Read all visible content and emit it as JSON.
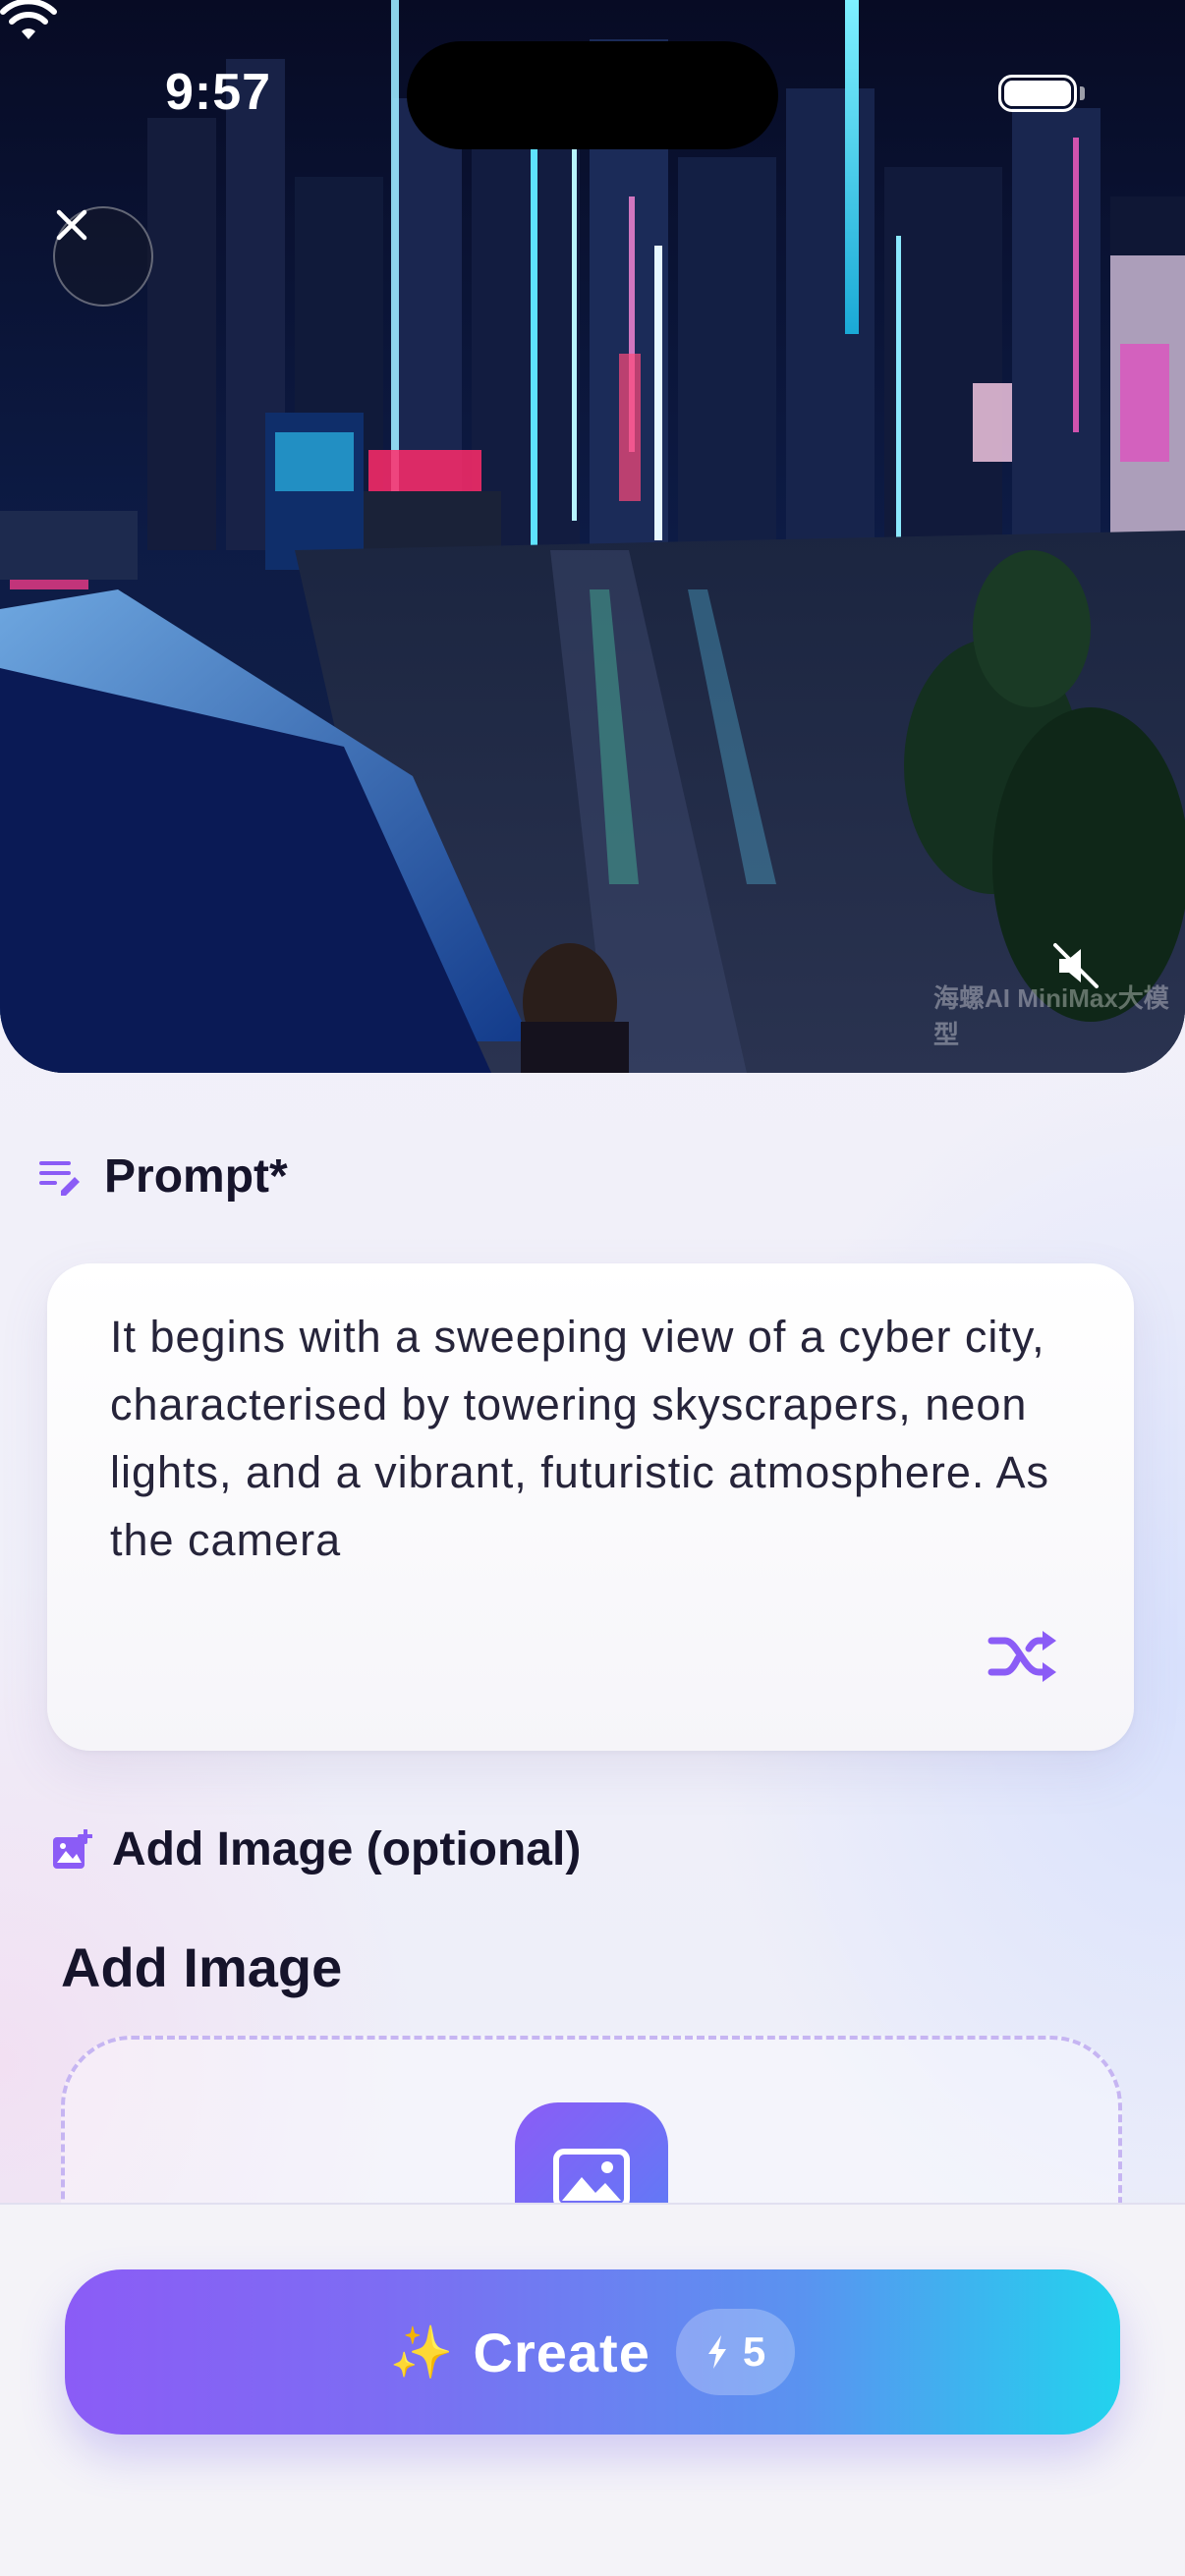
{
  "status_bar": {
    "time": "9:57"
  },
  "hero": {
    "close_icon": "close-icon",
    "mute_icon": "speaker-muted-icon",
    "watermark": "海螺AI MiniMax大模型"
  },
  "prompt_section": {
    "label": "Prompt*",
    "icon": "edit-lines-icon",
    "text": "It begins with a sweeping view of a cyber city, characterised by towering skyscrapers, neon lights, and a vibrant, futuristic atmosphere. As the camera",
    "shuffle_icon": "shuffle-icon"
  },
  "image_section": {
    "label": "Add Image (optional)",
    "icon": "add-photo-icon",
    "title": "Add Image",
    "upload_icon": "image-icon"
  },
  "create_button": {
    "label": "Create",
    "sparkle": "✨",
    "cost": "5",
    "cost_icon": "lightning-icon"
  },
  "colors": {
    "accent": "#8b5cf6",
    "gradient_start": "#8b5cf6",
    "gradient_end": "#22d3ee",
    "text_dark": "#16142b"
  }
}
